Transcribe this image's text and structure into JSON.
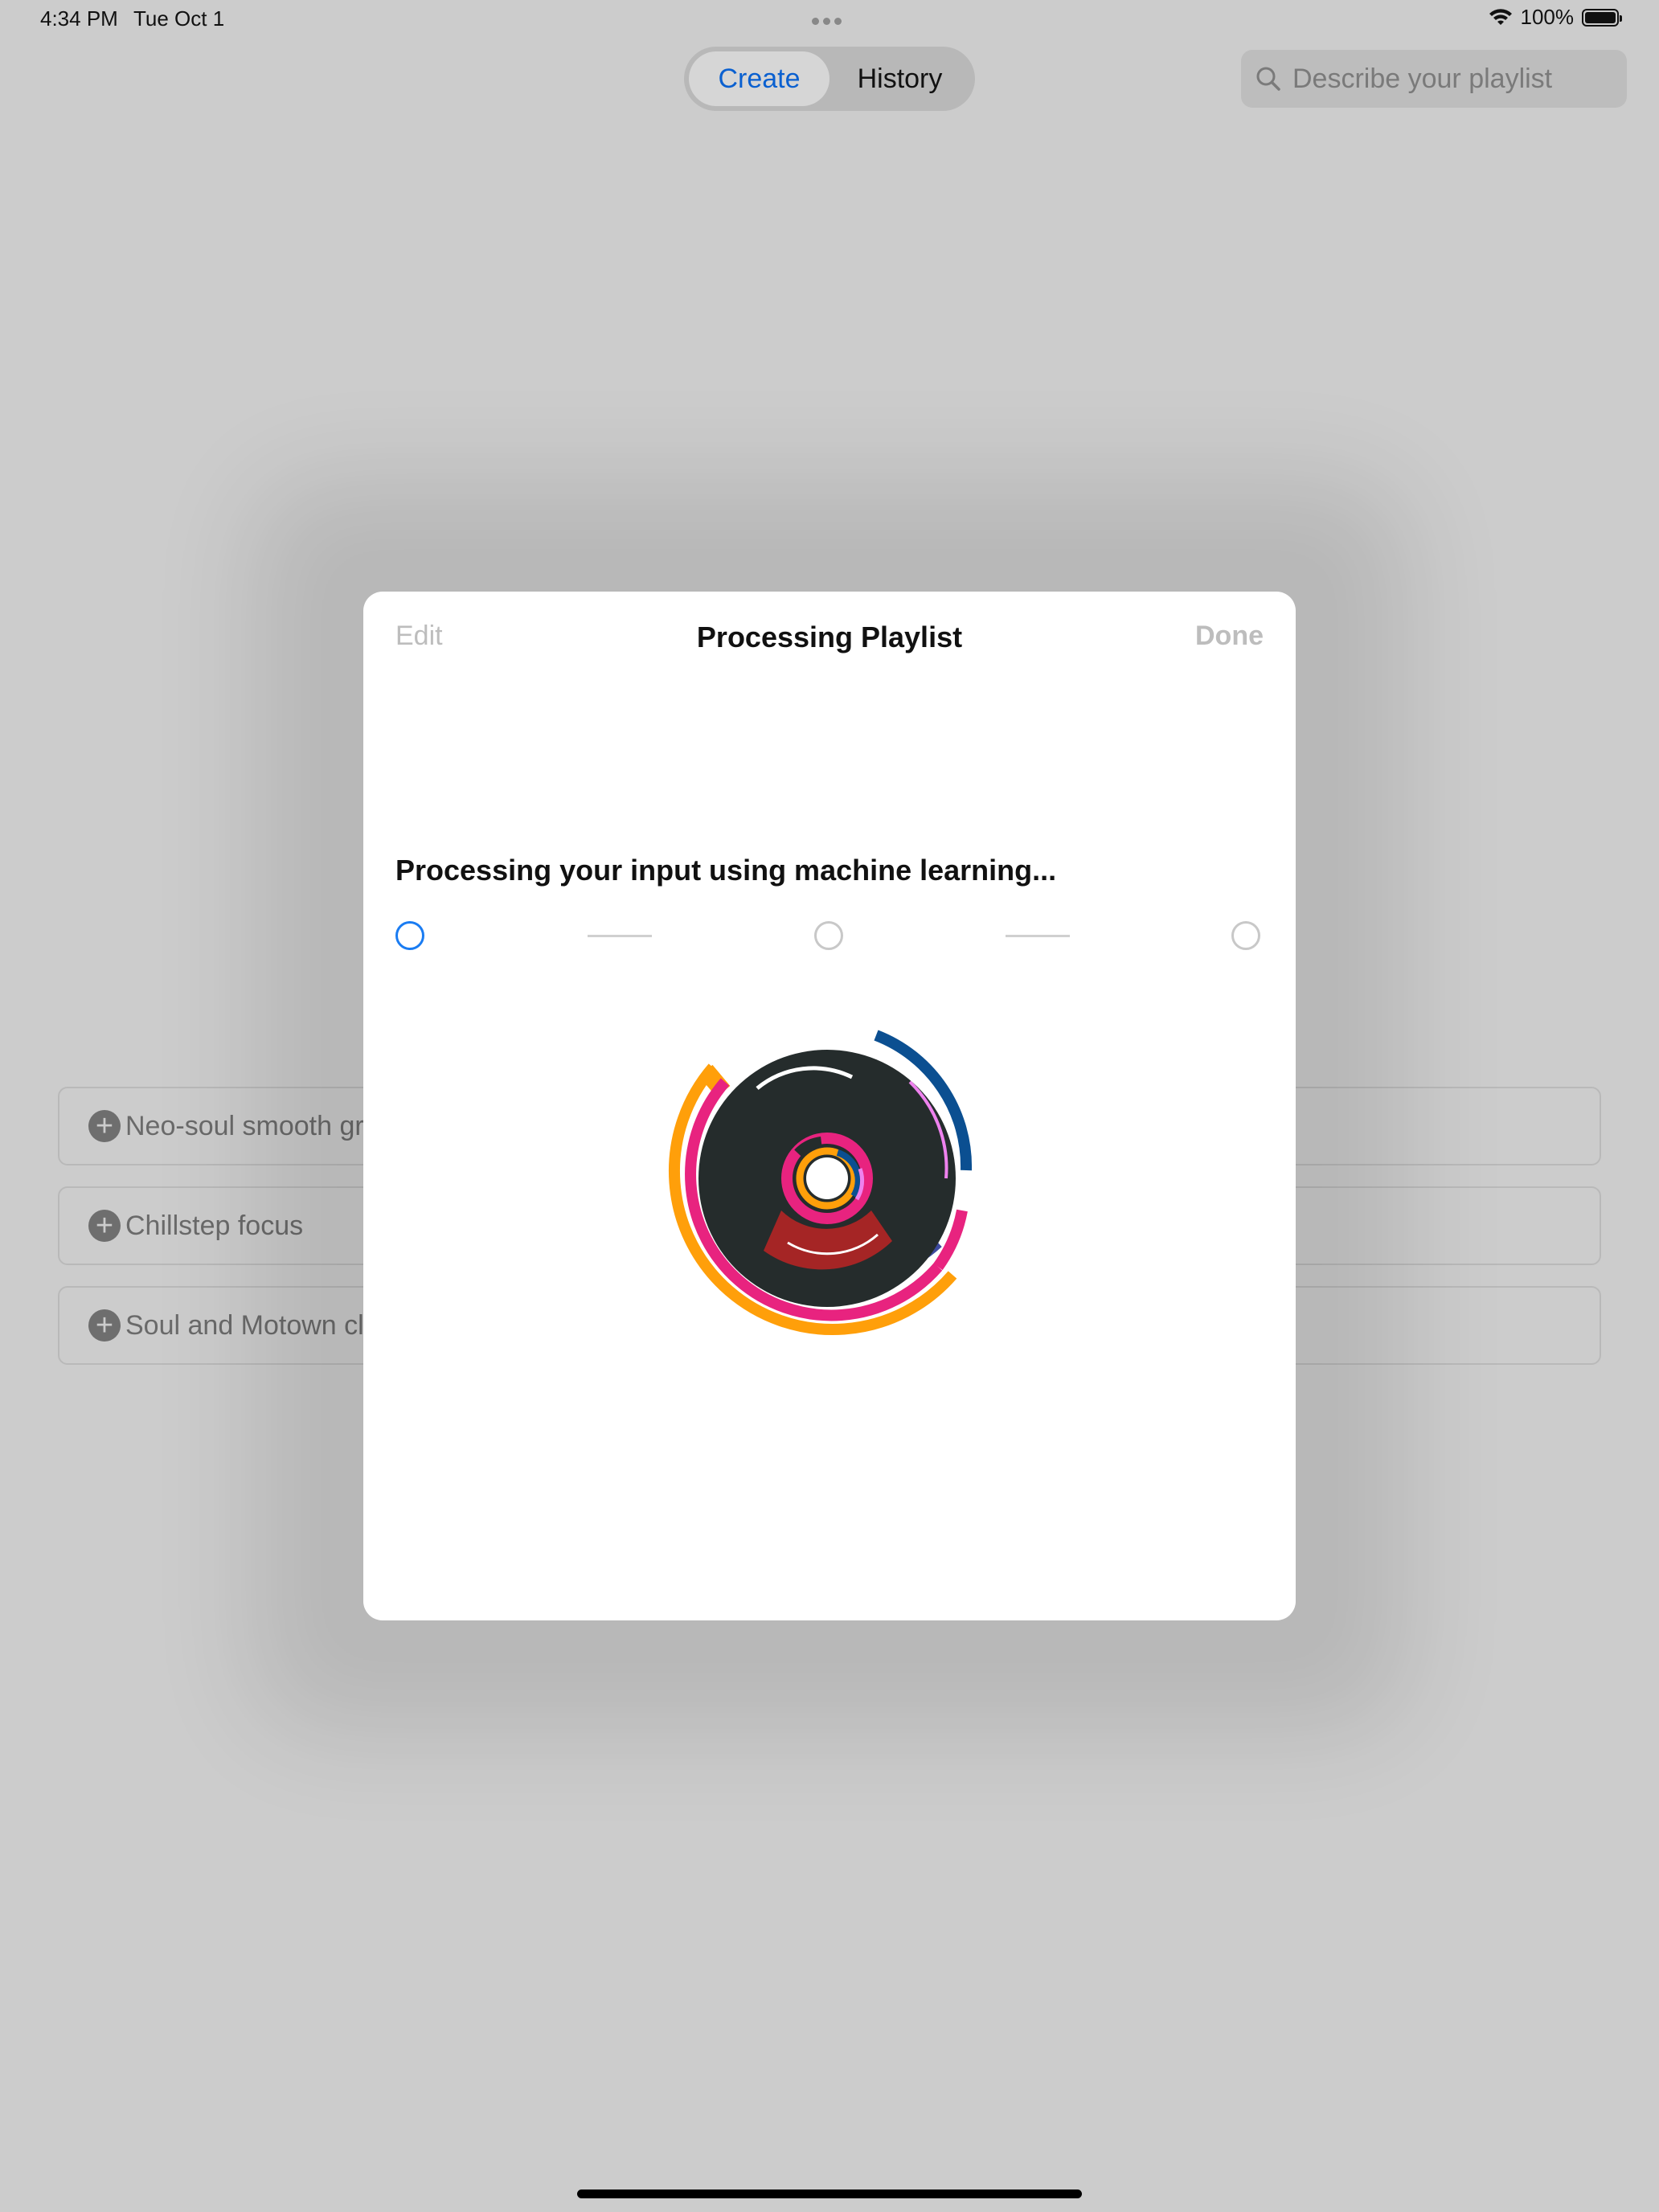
{
  "status_bar": {
    "time": "4:34 PM",
    "date": "Tue Oct 1",
    "battery_percent": "100%",
    "battery_level": 1.0
  },
  "tabs": {
    "create": "Create",
    "history": "History",
    "selected": "Create"
  },
  "search": {
    "placeholder": "Describe your playlist"
  },
  "playlists": [
    {
      "label": "Neo-soul smooth gr"
    },
    {
      "label": "Chillstep focus"
    },
    {
      "label": "Soul and Motown cla"
    }
  ],
  "modal": {
    "edit_label": "Edit",
    "title": "Processing Playlist",
    "done_label": "Done",
    "message": "Processing your input using machine learning...",
    "steps_total": 3,
    "current_step": 1
  },
  "colors": {
    "accent": "#0a60d0",
    "step_active": "#1a7cf2",
    "disc_dark": "#252c2c",
    "orange": "#ff9f0a",
    "pink": "#e8237f",
    "blue": "#0b4f91",
    "red": "#a52525",
    "light_pink": "#ee82ee"
  },
  "icons": {
    "search": "magnifying-glass-icon",
    "wifi": "wifi-icon",
    "battery": "battery-icon",
    "add": "plus-circle-icon",
    "art": "music-disc-icon"
  }
}
